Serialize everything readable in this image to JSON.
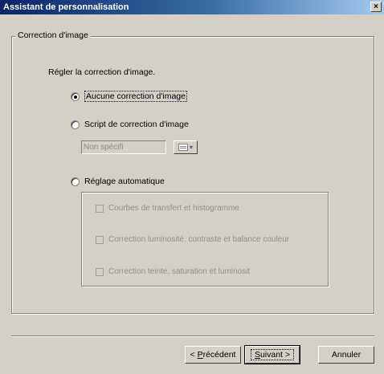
{
  "window": {
    "title": "Assistant de personnalisation",
    "close_glyph": "×"
  },
  "group": {
    "label": "Correction d'image"
  },
  "instruction": "Régler la correction d'image.",
  "options": {
    "none": {
      "label": "Aucune correction d'image",
      "selected": true
    },
    "script": {
      "label": "Script de correction d'image",
      "selected": false
    },
    "auto": {
      "label": "Réglage automatique",
      "selected": false
    }
  },
  "script_field": {
    "value": "Non spécifi",
    "browse_icon": "list-icon"
  },
  "auto_options": [
    {
      "label": "Courbes de transfert et histogramme",
      "checked": false
    },
    {
      "label": "Correction luminosité, contraste et balance couleur",
      "checked": false
    },
    {
      "label": "Correction teinte, saturation et luminosit",
      "checked": false
    }
  ],
  "buttons": {
    "back": {
      "prefix": "< ",
      "accel": "P",
      "rest": "récédent"
    },
    "next": {
      "accel": "S",
      "rest": "uivant",
      "suffix": " >"
    },
    "cancel": "Annuler"
  }
}
